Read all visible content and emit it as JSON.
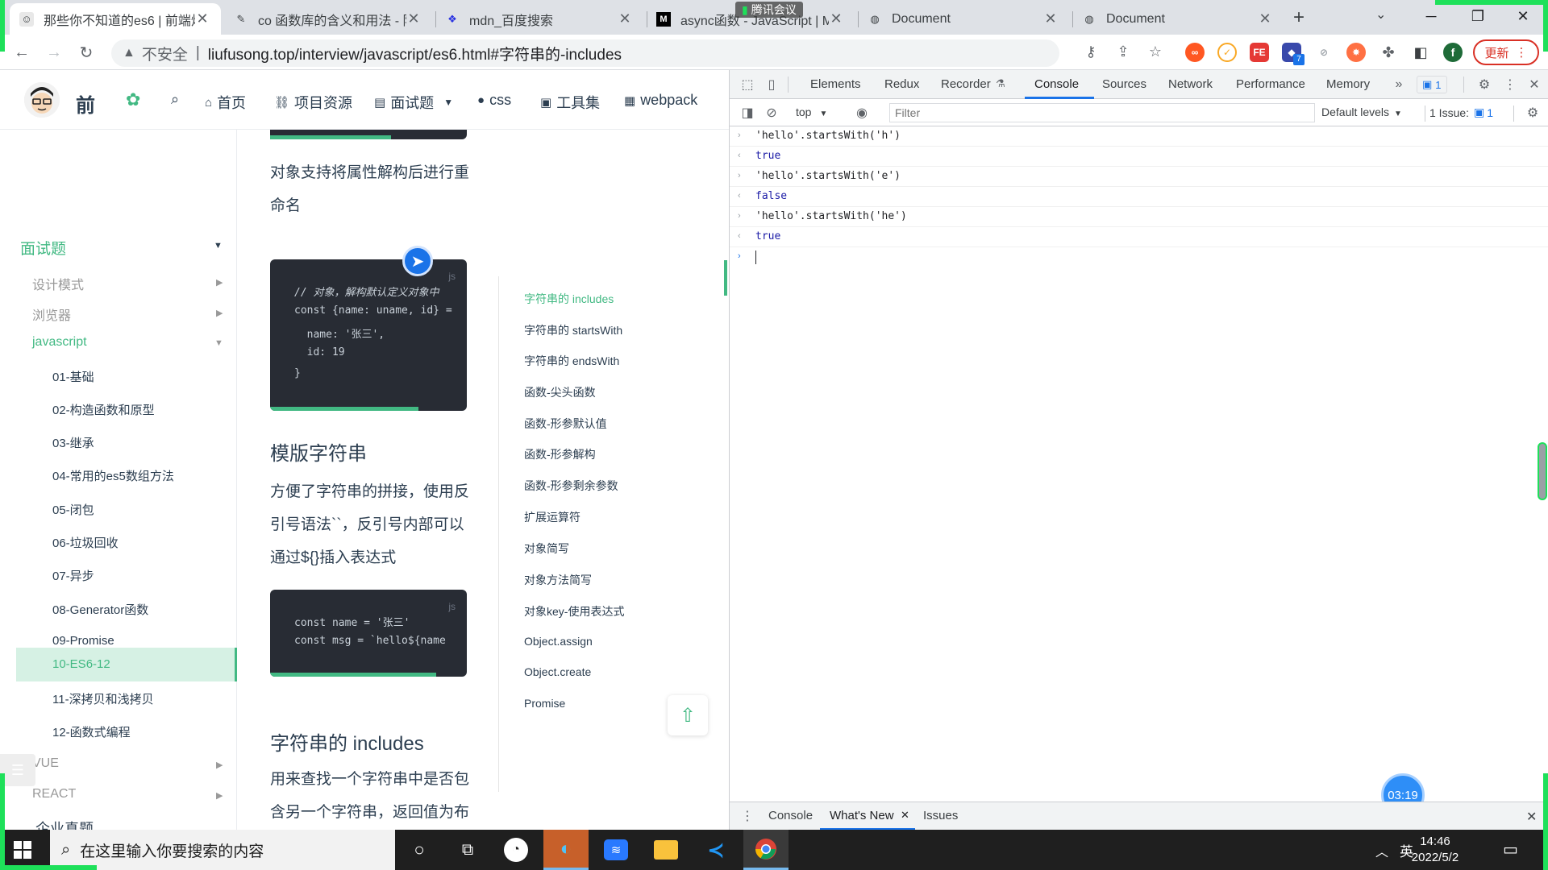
{
  "browser": {
    "tabs": [
      {
        "title": "那些你不知道的es6 | 前端炸",
        "icon": "avatar-favicon",
        "active": true
      },
      {
        "title": "co 函数库的含义和用法 - 阮",
        "icon": "feather-favicon",
        "active": false
      },
      {
        "title": "mdn_百度搜索",
        "icon": "baidu-paw-favicon",
        "active": false
      },
      {
        "title": "async函数 - JavaScript | M",
        "icon": "mdn-favicon",
        "active": false
      },
      {
        "title": "Document",
        "icon": "globe-favicon",
        "active": false
      },
      {
        "title": "Document",
        "icon": "globe-favicon",
        "active": false
      }
    ],
    "meeting_overlay": "腾讯会议",
    "address": {
      "security": "不安全",
      "url": "liufusong.top/interview/javascript/es6.html#字符串的-includes"
    },
    "update_label": "更新",
    "profile_initial": "f",
    "extension_badge": "7"
  },
  "site": {
    "logo_text": "前",
    "nav": [
      {
        "label": "首页",
        "icon": "home-icon"
      },
      {
        "label": "项目资源",
        "icon": "link-icon"
      },
      {
        "label": "面试题",
        "icon": "list-icon",
        "has_dropdown": true
      },
      {
        "label": "css",
        "icon": "circle-icon"
      },
      {
        "label": "工具集",
        "icon": "box-icon"
      },
      {
        "label": "webpack",
        "icon": "grid-icon"
      }
    ]
  },
  "sidebar": {
    "group": "面试题",
    "sections": [
      {
        "label": "设计模式"
      },
      {
        "label": "浏览器"
      },
      {
        "label": "javascript"
      }
    ],
    "items": [
      "01-基础",
      "02-构造函数和原型",
      "03-继承",
      "04-常用的es5数组方法",
      "05-闭包",
      "06-垃圾回收",
      "07-异步",
      "08-Generator函数",
      "09-Promise",
      "10-ES6-12",
      "11-深拷贝和浅拷贝",
      "12-函数式编程"
    ],
    "bottom_sections": [
      "VUE",
      "REACT"
    ],
    "footer_link": "企业真题"
  },
  "content": {
    "para1": "对象支持将属性解构后进行重命名",
    "code1": {
      "lang": "js",
      "lines": [
        "// 对象，解构默认定义对象中",
        "const {name: uname, id} =",
        "  name: '张三',",
        "  id: 19",
        "}"
      ]
    },
    "h2_template": "模版字符串",
    "para2": "方便了字符串的拼接，使用反引号语法``，反引号内部可以通过${}插入表达式",
    "code2": {
      "lang": "js",
      "lines": [
        "const name = '张三'",
        "const msg = `hello${name"
      ]
    },
    "h2_includes": "字符串的 includes",
    "para3": "用来查找一个字符串中是否包含另一个字符串，返回值为布"
  },
  "toc": {
    "items": [
      "字符串的 includes",
      "字符串的 startsWith",
      "字符串的 endsWith",
      "函数-尖头函数",
      "函数-形参默认值",
      "函数-形参解构",
      "函数-形参剩余参数",
      "扩展运算符",
      "对象简写",
      "对象方法简写",
      "对象key-使用表达式",
      "Object.assign",
      "Object.create",
      "Promise"
    ]
  },
  "devtools": {
    "tabs": [
      "Elements",
      "Redux",
      "Recorder",
      "Console",
      "Sources",
      "Network",
      "Performance",
      "Memory"
    ],
    "active_tab": "Console",
    "issues_badge": "1",
    "context": "top",
    "filter_placeholder": "Filter",
    "levels": "Default levels",
    "issues_label": "1 Issue:",
    "issues_count": "1",
    "console": [
      {
        "type": "input",
        "text": "'hello'.startsWith('h')"
      },
      {
        "type": "output",
        "text": "true"
      },
      {
        "type": "input",
        "text": "'hello'.startsWith('e')"
      },
      {
        "type": "output",
        "text": "false"
      },
      {
        "type": "input",
        "text": "'hello'.startsWith('he')"
      },
      {
        "type": "output",
        "text": "true"
      }
    ],
    "drawer_tabs": [
      "Console",
      "What's New",
      "Issues"
    ]
  },
  "meeting_timer": "03:19",
  "taskbar": {
    "search_placeholder": "在这里输入你要搜索的内容",
    "ime": "英",
    "time": "14:46",
    "date": "2022/5/2"
  }
}
